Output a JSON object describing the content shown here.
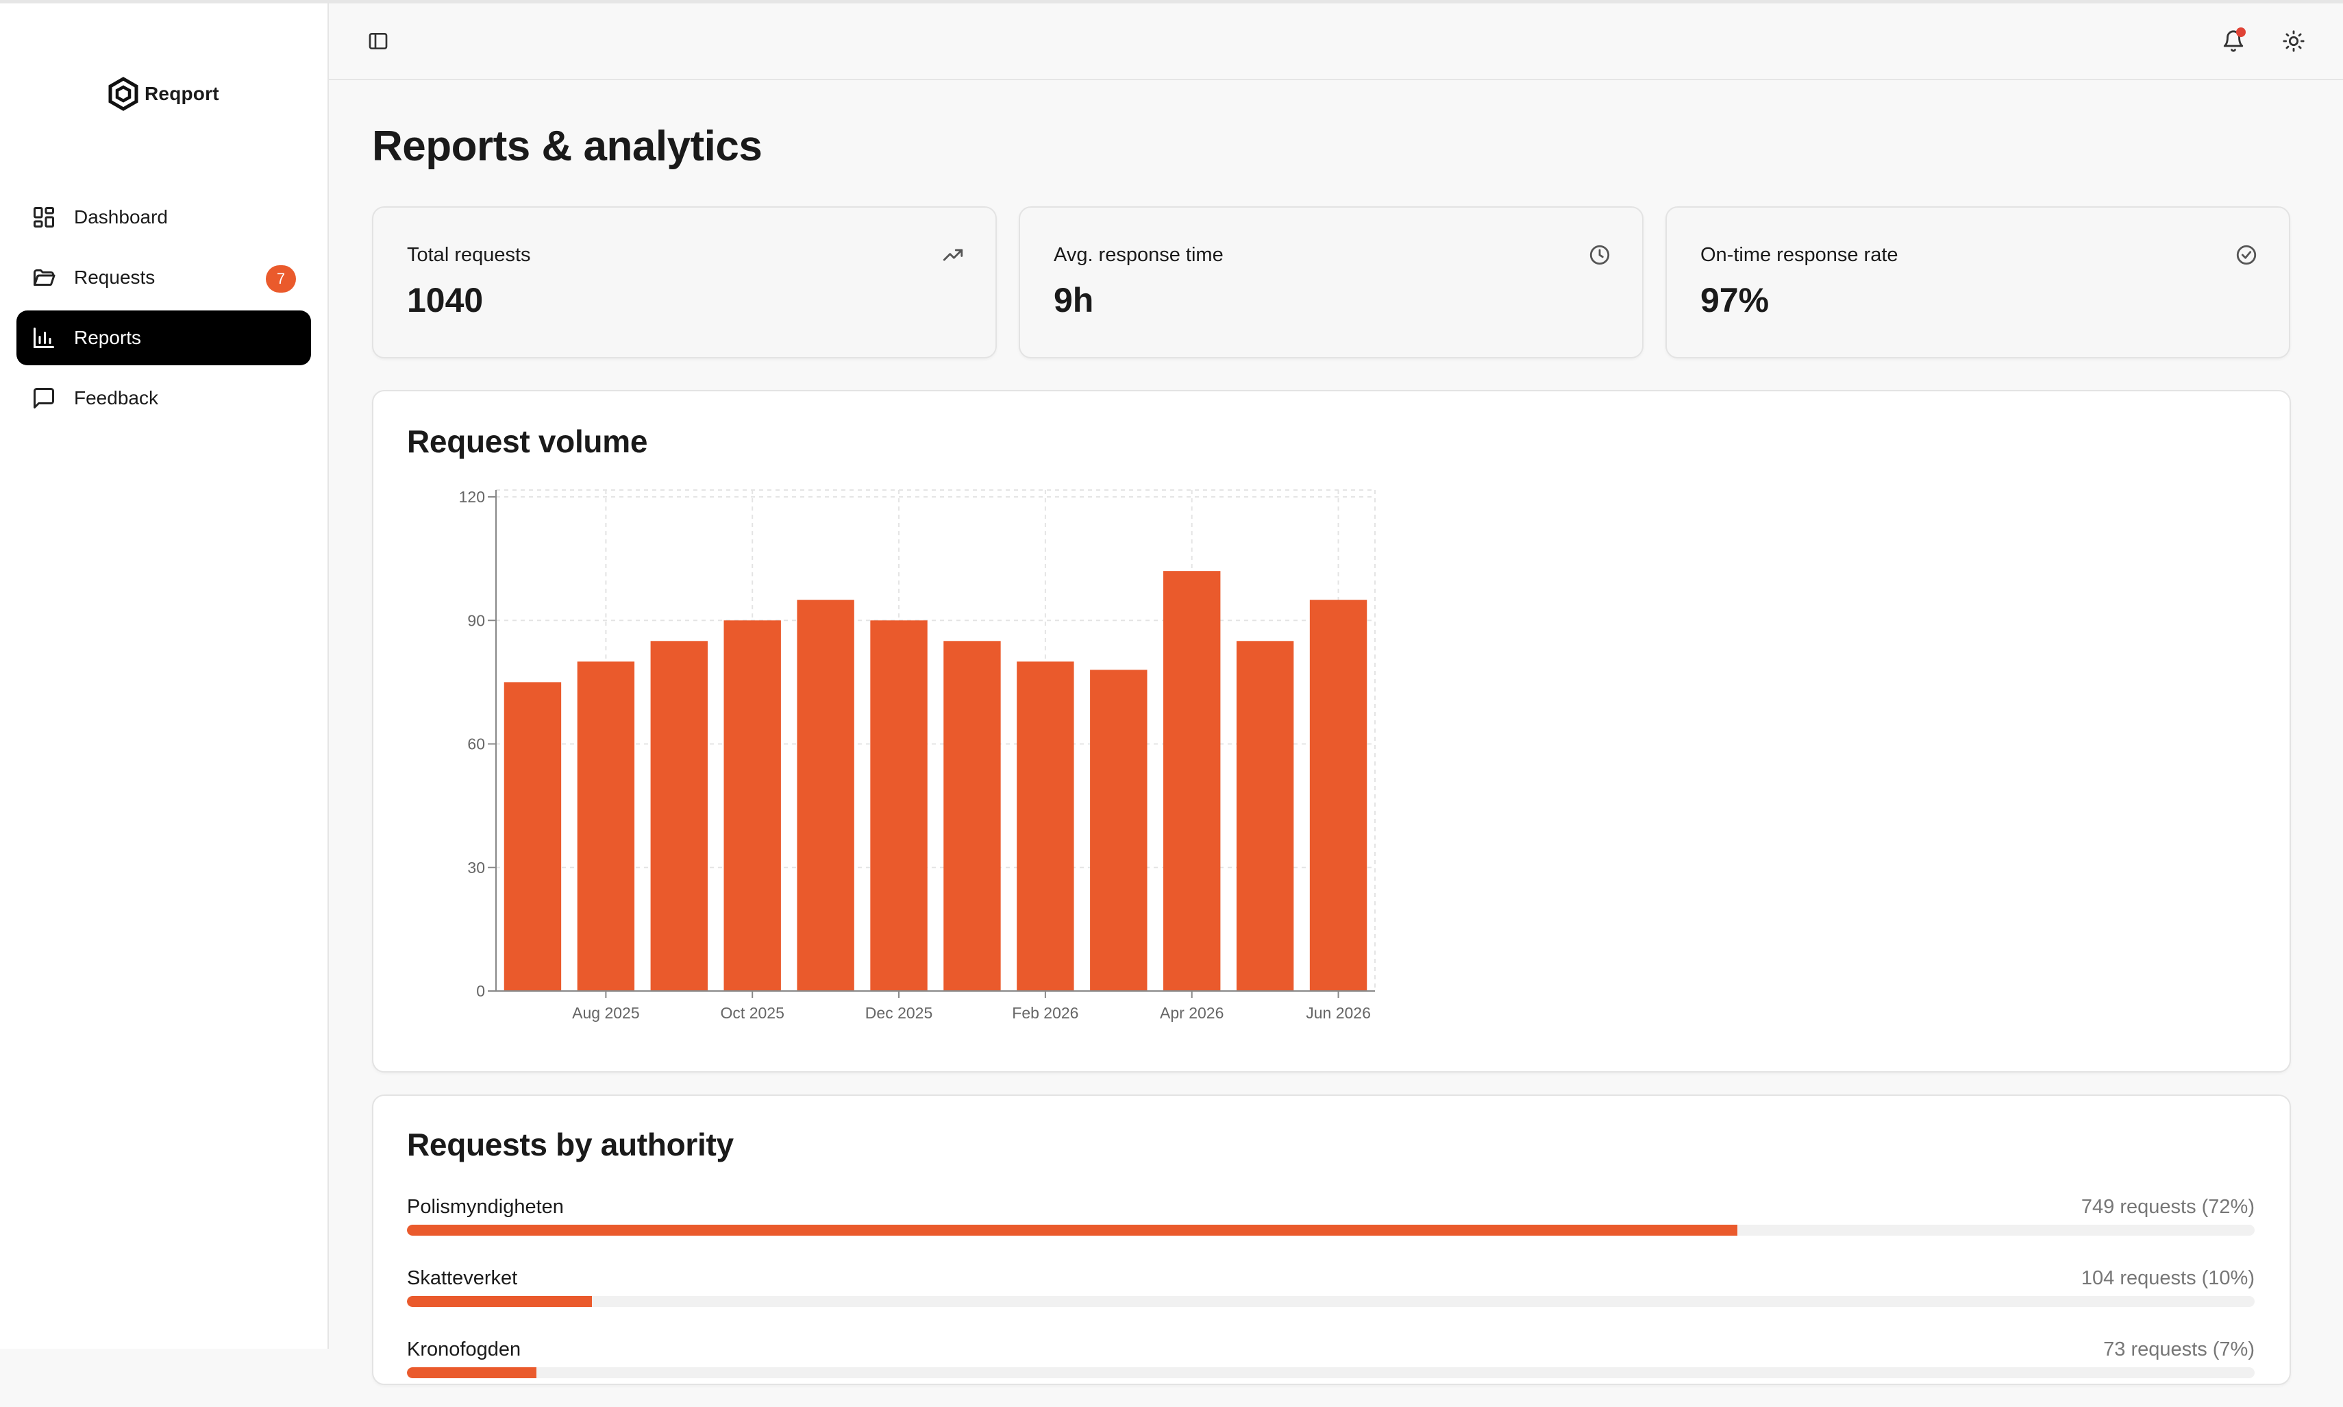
{
  "app": {
    "brand": "Reqport"
  },
  "sidebar": {
    "items": [
      {
        "label": "Dashboard",
        "icon": "dashboard-icon",
        "active": false
      },
      {
        "label": "Requests",
        "icon": "folder-icon",
        "active": false,
        "badge": "7"
      },
      {
        "label": "Reports",
        "icon": "bar-chart-icon",
        "active": true
      },
      {
        "label": "Feedback",
        "icon": "message-square-icon",
        "active": false
      }
    ]
  },
  "header": {
    "icons": [
      "sidebar-toggle-icon",
      "bell-icon",
      "sun-icon"
    ],
    "has_notification": true
  },
  "page": {
    "title": "Reports & analytics"
  },
  "stats": [
    {
      "label": "Total requests",
      "value": "1040",
      "icon": "trending-up-icon"
    },
    {
      "label": "Avg. response time",
      "value": "9h",
      "icon": "clock-icon"
    },
    {
      "label": "On-time response rate",
      "value": "97%",
      "icon": "check-circle-icon"
    }
  ],
  "volume": {
    "title": "Request volume"
  },
  "chart_data": {
    "type": "bar",
    "title": "Request volume",
    "categories": [
      "Jul 2025",
      "Aug 2025",
      "Sep 2025",
      "Oct 2025",
      "Nov 2025",
      "Dec 2025",
      "Jan 2026",
      "Feb 2026",
      "Mar 2026",
      "Apr 2026",
      "May 2026",
      "Jun 2026"
    ],
    "values": [
      75,
      80,
      85,
      90,
      95,
      90,
      85,
      80,
      78,
      102,
      85,
      95
    ],
    "x_tick_labels": [
      "Aug 2025",
      "Oct 2025",
      "Dec 2025",
      "Feb 2026",
      "Apr 2026",
      "Jun 2026"
    ],
    "y_ticks": [
      0,
      30,
      60,
      90,
      120
    ],
    "ylim": [
      0,
      120
    ],
    "grid": true,
    "color": "#ea5a2c"
  },
  "authority": {
    "title": "Requests by authority",
    "rows": [
      {
        "name": "Polismyndigheten",
        "stat": "749 requests (72%)",
        "fraction": 0.72
      },
      {
        "name": "Skatteverket",
        "stat": "104 requests (10%)",
        "fraction": 0.1
      },
      {
        "name": "Kronofogden",
        "stat": "73 requests (7%)",
        "fraction": 0.07
      }
    ]
  },
  "colors": {
    "accent": "#ea5a2c",
    "active_nav": "#000000",
    "notification": "#e04336"
  }
}
